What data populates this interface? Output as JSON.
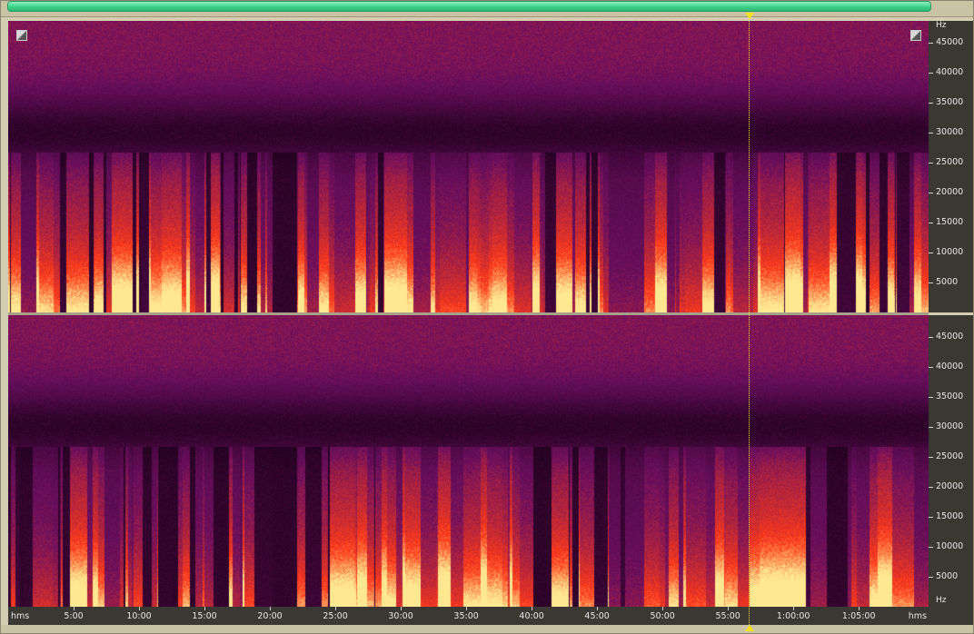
{
  "frequency_axis": {
    "unit": "Hz",
    "max_hz": 48000,
    "ticks": [
      45000,
      40000,
      35000,
      30000,
      25000,
      20000,
      15000,
      10000,
      5000
    ]
  },
  "time_axis": {
    "unit_left": "hms",
    "unit_right": "hms",
    "total_seconds": 4220,
    "ticks": [
      {
        "label": "5:00",
        "seconds": 300
      },
      {
        "label": "10:00",
        "seconds": 600
      },
      {
        "label": "15:00",
        "seconds": 900
      },
      {
        "label": "20:00",
        "seconds": 1200
      },
      {
        "label": "25:00",
        "seconds": 1500
      },
      {
        "label": "30:00",
        "seconds": 1800
      },
      {
        "label": "35:00",
        "seconds": 2100
      },
      {
        "label": "40:00",
        "seconds": 2400
      },
      {
        "label": "45:00",
        "seconds": 2700
      },
      {
        "label": "50:00",
        "seconds": 3000
      },
      {
        "label": "55:00",
        "seconds": 3300
      },
      {
        "label": "1:00:00",
        "seconds": 3600
      },
      {
        "label": "1:05:00",
        "seconds": 3900
      }
    ]
  },
  "playhead_seconds": 3500,
  "colors": {
    "scrollbar": "#3fd28a",
    "playhead": "#f3e218",
    "spectrogram_low": "#1a0018",
    "spectrogram_mid": "#6a0f5e",
    "spectrogram_high": "#ff3b1a",
    "spectrogram_peak": "#ffe890"
  },
  "icons": {
    "corner_left": "resize-corner-icon",
    "corner_right": "resize-corner-icon",
    "playhead_marker": "triangle-marker-icon"
  }
}
